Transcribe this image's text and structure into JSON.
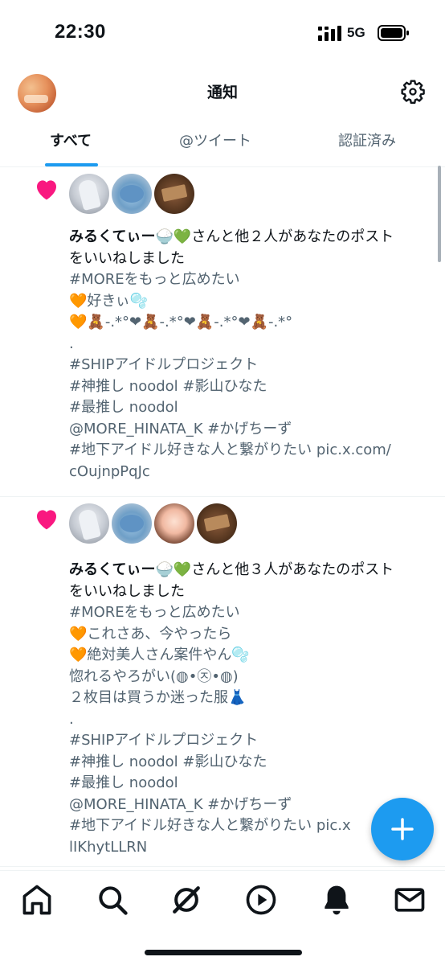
{
  "status_bar": {
    "time": "22:30",
    "network": "5G"
  },
  "header": {
    "title": "通知",
    "avatar_icon": "profile-avatar",
    "settings_icon": "gear-icon"
  },
  "tabs": [
    {
      "label": "すべて",
      "active": true
    },
    {
      "label": "@ツイート",
      "active": false
    },
    {
      "label": "認証済み",
      "active": false
    }
  ],
  "notifications": [
    {
      "type": "like",
      "icon": "heart-icon",
      "actor": "みるくてぃー🍚💚",
      "headline_rest": "さんと他２人があなたのポスト",
      "headline_line2": "をいいねしました",
      "body_lines": [
        "#MOREをもっと広めたい",
        "🧡好きぃ🫧",
        "🧡🧸-.*°❤🧸-.*°❤🧸-.*°❤🧸-.*°",
        ".",
        "#SHIPアイドルプロジェクト",
        "#神推し noodol #影山ひなた",
        "#最推し noodol",
        "@MORE_HINATA_K #かげちーず",
        "#地下アイドル好きな人と繋がりたい pic.x.com/",
        "cOujnpPqJc"
      ]
    },
    {
      "type": "like",
      "icon": "heart-icon",
      "actor": "みるくてぃー🍚💚",
      "headline_rest": "さんと他３人があなたのポスト",
      "headline_line2": "をいいねしました",
      "body_lines": [
        "#MOREをもっと広めたい",
        "🧡これさあ、今やったら",
        "🧡絶対美人さん案件やん🫧",
        "惚れるやろがい(◍•㉨•◍)",
        "２枚目は買うか迷った服👗",
        ".",
        "#SHIPアイドルプロジェクト",
        "#神推し noodol #影山ひなた",
        "#最推し noodol",
        "@MORE_HINATA_K #かげちーず",
        "#地下アイドル好きな人と繋がりたい pic.x",
        "lIKhytLLRN"
      ]
    }
  ],
  "fab": {
    "icon": "plus-icon"
  },
  "bottom_nav": [
    {
      "name": "home",
      "icon": "home-icon"
    },
    {
      "name": "search",
      "icon": "search-icon"
    },
    {
      "name": "grok",
      "icon": "grok-icon"
    },
    {
      "name": "video",
      "icon": "play-icon"
    },
    {
      "name": "notifications",
      "icon": "bell-icon",
      "active": true
    },
    {
      "name": "messages",
      "icon": "mail-icon"
    }
  ],
  "colors": {
    "accent": "#1d9bf0",
    "heart": "#f91880",
    "text": "#0f1419",
    "secondary": "#536471"
  }
}
